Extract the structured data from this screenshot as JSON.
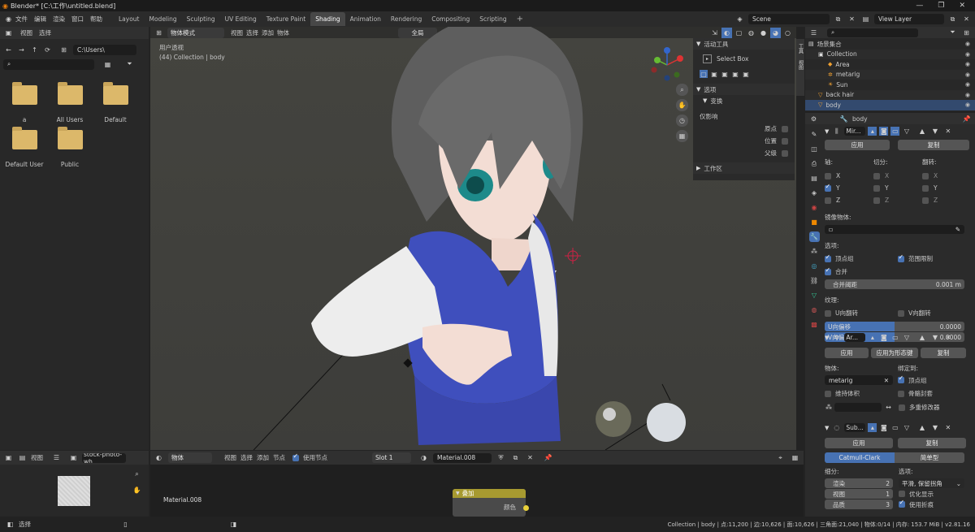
{
  "titlebar": {
    "title": "Blender* [C:\\工作\\untitled.blend]"
  },
  "menu": [
    "文件",
    "编辑",
    "渲染",
    "窗口",
    "帮助"
  ],
  "workspaces": [
    "Layout",
    "Modeling",
    "Sculpting",
    "UV Editing",
    "Texture Paint",
    "Shading",
    "Animation",
    "Rendering",
    "Compositing",
    "Scripting"
  ],
  "workspace_active": "Shading",
  "scene": {
    "label": "Scene",
    "view_layer": "View Layer"
  },
  "filebrowser": {
    "menu": [
      "视图",
      "选择"
    ],
    "path": "C:\\Users\\",
    "items": [
      "a",
      "All Users",
      "Default",
      "Default User",
      "Public"
    ]
  },
  "viewport": {
    "mode": "物体模式",
    "menu": [
      "视图",
      "选择",
      "添加",
      "物体"
    ],
    "orientation": "全局",
    "overlay_title": "用户透视",
    "overlay_sub": "(44) Collection | body"
  },
  "npanel": {
    "active_tool": "活动工具",
    "select_box": "Select Box",
    "options": "选项",
    "transform": "变换",
    "affect_only": "仅影响",
    "origin": "原点",
    "location": "位置",
    "parent": "父级",
    "workspace": "工作区",
    "tabs": [
      "工具",
      "视图"
    ]
  },
  "outliner": {
    "root": "场景集合",
    "items": [
      "Collection",
      "Area",
      "metarig",
      "Sun",
      "back hair",
      "body"
    ]
  },
  "properties": {
    "object": "body",
    "mirror": {
      "name": "Mir...",
      "apply": "应用",
      "copy": "复制",
      "axis": "轴:",
      "bisect": "切分:",
      "flip": "翻转:",
      "x": "X",
      "y": "Y",
      "z": "Z",
      "mirror_object": "镜像物体:",
      "options": "选项:",
      "vertex_groups": "顶点组",
      "clipping": "范围限制",
      "merge": "合并",
      "merge_limit": "合并阈距",
      "merge_value": "0.001 m",
      "texture": "纹理:",
      "u_flip": "U向翻转",
      "v_flip": "V向翻转",
      "u_offset": "U向偏移",
      "v_offset": "V向偏移",
      "u_value": "0.0000",
      "v_value": "0.0000"
    },
    "armature": {
      "name": "Ar...",
      "apply": "应用",
      "apply_shape": "应用为形态键",
      "copy": "复制",
      "object": "物体:",
      "bind_to": "绑定到:",
      "object_value": "metarig",
      "vertex_groups": "顶点组",
      "preserve_volume": "维持体积",
      "bone_envelopes": "骨骼封套",
      "multi_modifier": "多重修改器"
    },
    "subsurf": {
      "name": "Sub...",
      "apply": "应用",
      "copy": "复制",
      "catmull": "Catmull-Clark",
      "simple": "简单型",
      "subdivisions": "细分:",
      "options": "选项:",
      "render": "渲染",
      "render_val": "2",
      "viewport": "视图",
      "viewport_val": "1",
      "quality": "品质",
      "quality_val": "3",
      "smooth": "平滑, 保留拐角",
      "optimal": "优化显示",
      "limit": "使用折痕"
    }
  },
  "image_editor": {
    "menu": "视图",
    "image": "stock-photo-wh"
  },
  "node_editor": {
    "type": "物体",
    "menu": [
      "视图",
      "选择",
      "添加",
      "节点"
    ],
    "use_nodes": "使用节点",
    "slot": "Slot 1",
    "material": "Material.008",
    "node_title": "叠加",
    "node_socket": "颜色",
    "label": "Material.008"
  },
  "statusbar": {
    "left": "选择",
    "right": "Collection | body | 点:11,200 | 边:10,626 | 面:10,626 | 三角面:21,040 | 物体:0/14 | 内存: 153.7 MiB | v2.81.16"
  },
  "colors": {
    "accent": "#4772b3",
    "node_header": "#a79a30",
    "viewport_bg": "#3f3f3f"
  }
}
